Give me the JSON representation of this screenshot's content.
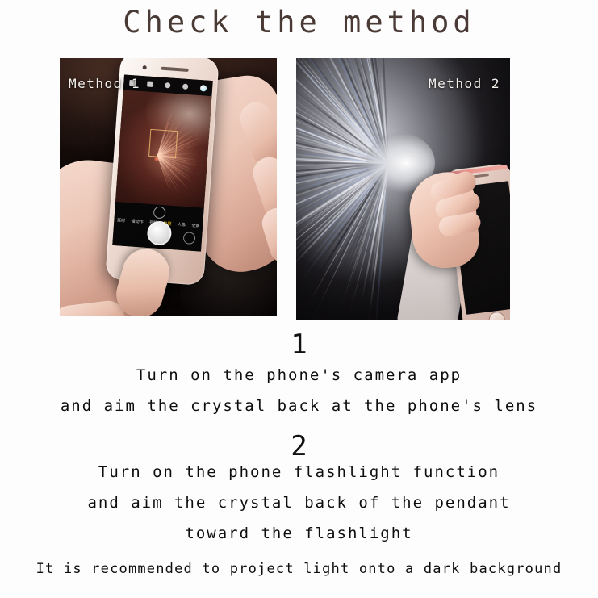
{
  "title": "Check the method",
  "panels": [
    {
      "label": "Method 1",
      "name": "method-1"
    },
    {
      "label": "Method 2",
      "name": "method-2"
    }
  ],
  "camera_ui": {
    "modes": [
      "延时",
      "慢动作",
      "视频",
      "拍照",
      "人像",
      "全景"
    ]
  },
  "steps": [
    {
      "number": "1",
      "lines": [
        "Turn on the phone's camera app",
        "and aim the crystal back at the phone's lens"
      ]
    },
    {
      "number": "2",
      "lines": [
        "Turn on the phone flashlight function",
        "and aim the crystal back of the pendant",
        "toward the flashlight"
      ]
    }
  ],
  "note": "It is recommended to project light onto a dark background",
  "colors": {
    "background": "#fdfdfd",
    "title": "#4a3a35",
    "body_text": "#0d0d0d",
    "label_text": "#f6f2ee"
  }
}
